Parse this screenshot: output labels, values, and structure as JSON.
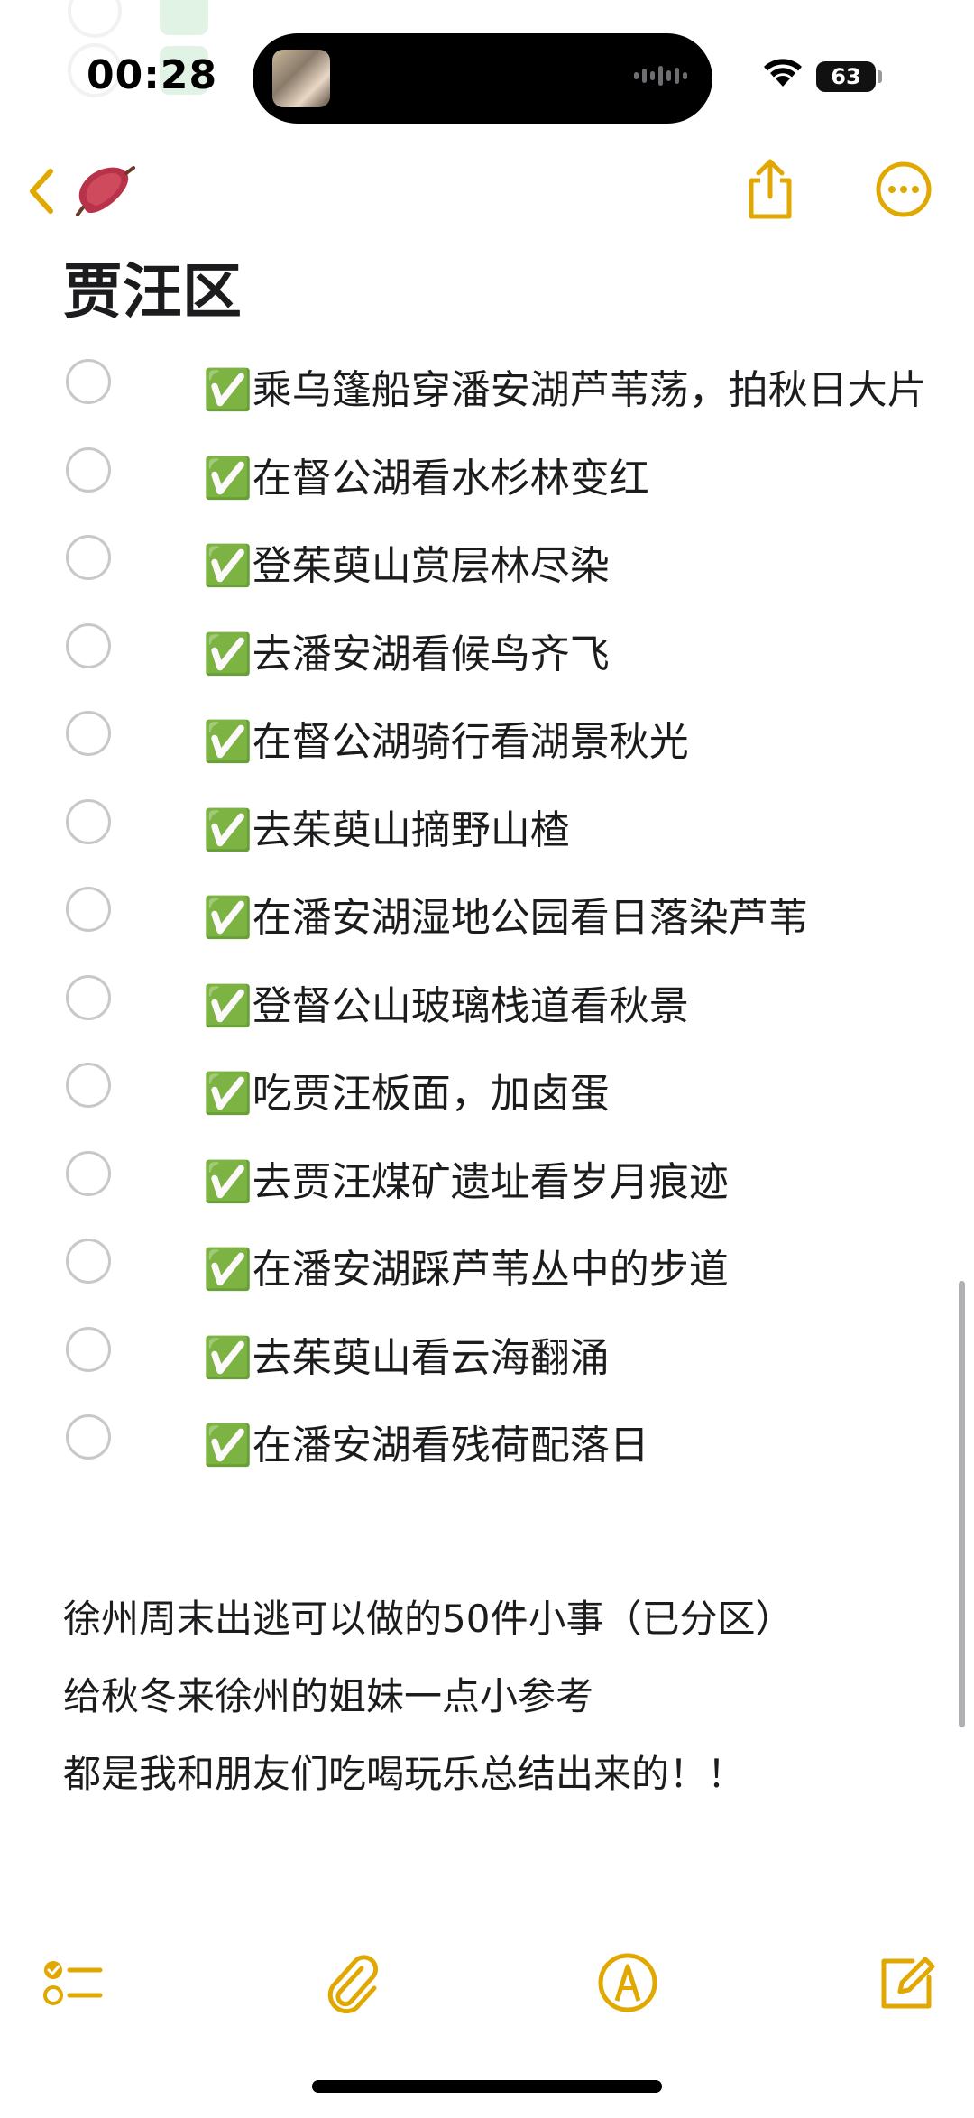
{
  "status_bar": {
    "time": "00:28",
    "battery": "63"
  },
  "nav": {
    "back_icon": "chevron-left-icon",
    "note_emoji": "sweet-potato-emoji",
    "share_icon": "share-icon",
    "more_icon": "ellipsis-circle-icon",
    "accent_color": "#e0a800"
  },
  "note": {
    "title": "贾汪区",
    "checklist": [
      "✅乘乌篷船穿潘安湖芦苇荡，拍秋日大片",
      "✅在督公湖看水杉林变红",
      "✅登茱萸山赏层林尽染",
      "✅去潘安湖看候鸟齐飞",
      "✅在督公湖骑行看湖景秋光",
      "✅去茱萸山摘野山楂",
      "✅在潘安湖湿地公园看日落染芦苇",
      "✅登督公山玻璃栈道看秋景",
      "✅吃贾汪板面，加卤蛋",
      "✅去贾汪煤矿遗址看岁月痕迹",
      "✅在潘安湖踩芦苇丛中的步道",
      "✅去茱萸山看云海翻涌",
      "✅在潘安湖看残荷配落日"
    ],
    "body_lines": [
      "徐州周末出逃可以做的50件小事（已分区）",
      "给秋冬来徐州的姐妹一点小参考",
      "都是我和朋友们吃喝玩乐总结出来的！！"
    ]
  },
  "toolbar": {
    "items": [
      "checklist-icon",
      "paperclip-icon",
      "markup-pen-icon",
      "compose-icon"
    ]
  }
}
